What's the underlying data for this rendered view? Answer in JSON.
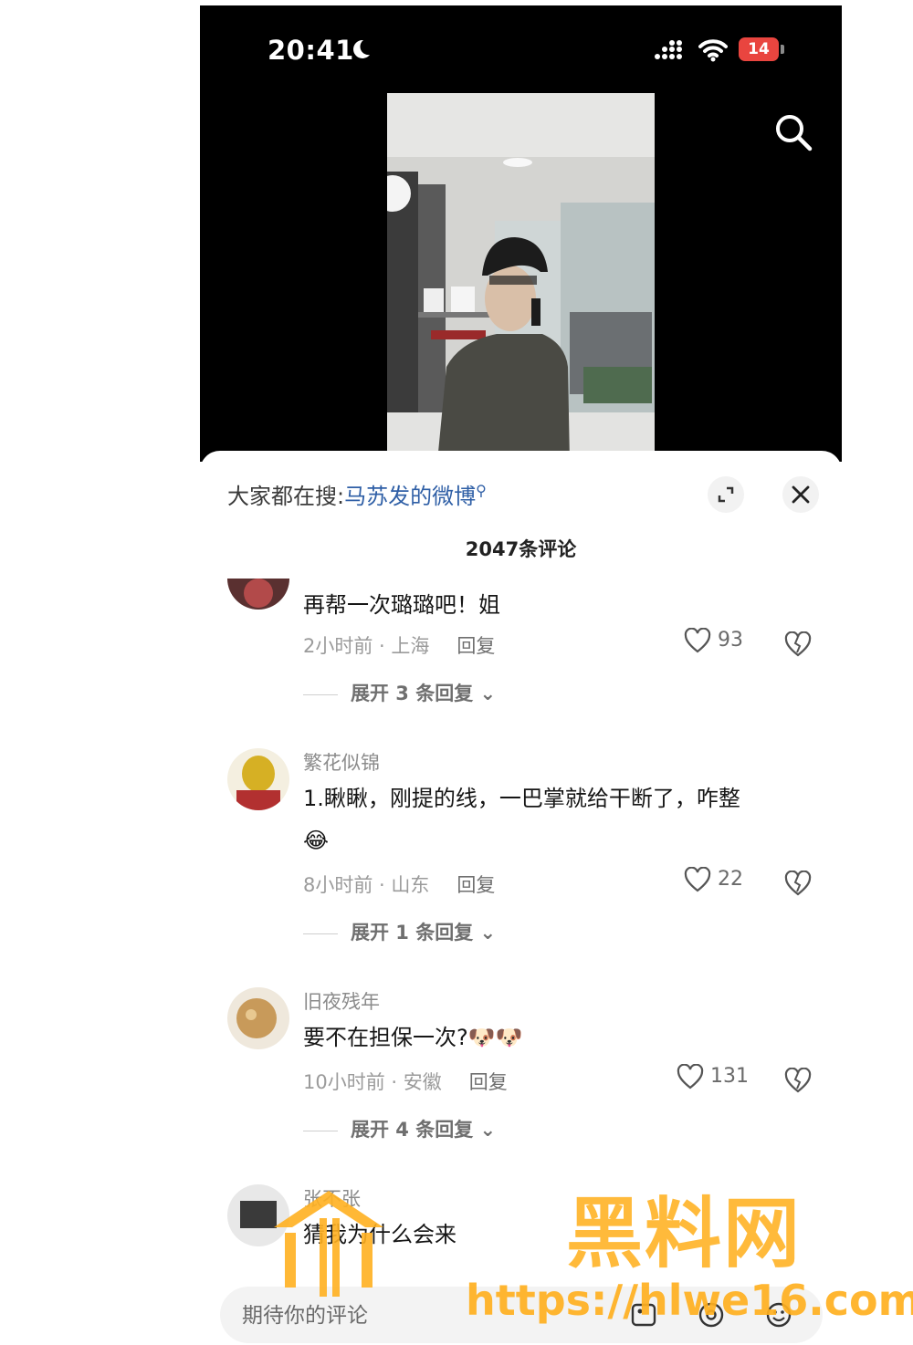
{
  "status_bar": {
    "time": "20:41",
    "battery": "14"
  },
  "sheet": {
    "hot_search_prefix": "大家都在搜:",
    "hot_search_term": "马苏发的微博",
    "comment_count": "2047条评论"
  },
  "comments": [
    {
      "username": "",
      "text": "再帮一次璐璐吧！姐",
      "time_location": "2小时前 · 上海",
      "reply_label": "回复",
      "likes": "93",
      "expand": "展开 3 条回复"
    },
    {
      "username": "繁花似锦",
      "text": "1.瞅瞅，刚提的线，一巴掌就给干断了，咋整",
      "emoji": "😂",
      "time_location": "8小时前 · 山东",
      "reply_label": "回复",
      "likes": "22",
      "expand": "展开 1 条回复"
    },
    {
      "username": "旧夜残年",
      "text": "要不在担保一次?",
      "emoji": "🐶🐶",
      "time_location": "10小时前 · 安徽",
      "reply_label": "回复",
      "likes": "131",
      "expand": "展开 4 条回复"
    },
    {
      "username": "张不张",
      "text": "猜我为什么会来"
    }
  ],
  "input": {
    "placeholder": "期待你的评论"
  },
  "watermark": {
    "text": "黑料网",
    "url": "https://hlwe16.com"
  },
  "colors": {
    "accent_link": "#2f5fa6",
    "watermark": "#ffb020",
    "battery": "#e9453f"
  }
}
